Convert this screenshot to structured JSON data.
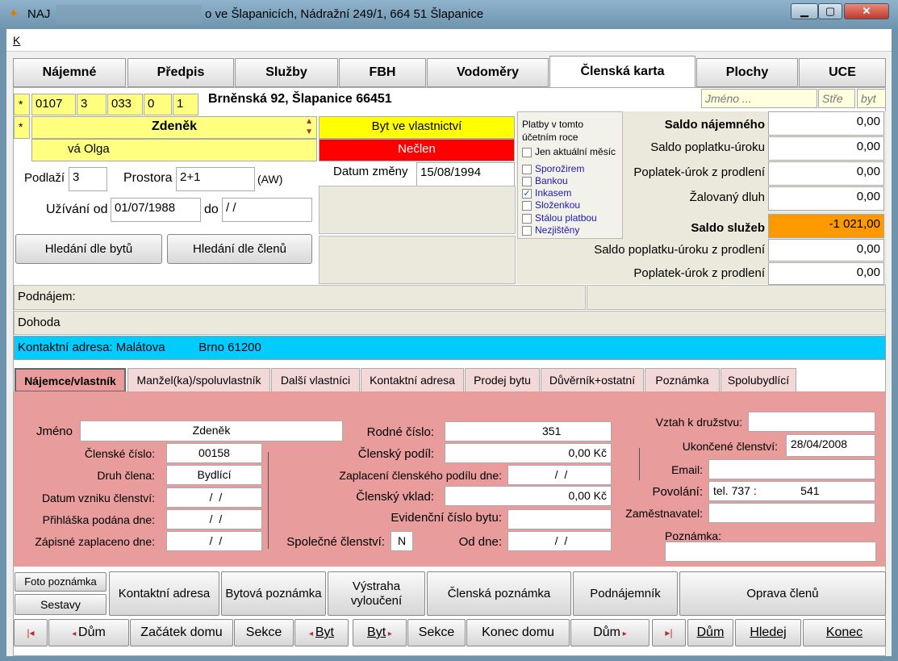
{
  "window": {
    "app": "NAJ",
    "title": "o ve Šlapanicích, Nádražní 249/1, 664 51  Šlapanice",
    "minimize": "▁",
    "maximize": "▢",
    "close": "✕"
  },
  "menu": {
    "item": "K"
  },
  "tabs": [
    "Nájemné",
    "Předpis",
    "Služby",
    "FBH",
    "Vodoměry",
    "Členská karta",
    "Plochy",
    "UCE"
  ],
  "active_tab": "Členská karta",
  "search": {
    "name_placeholder": "Jméno ...",
    "stre": "Stře",
    "byt": "byt"
  },
  "unit": {
    "marker": "*",
    "codes": [
      "0107",
      "3",
      "033",
      "0",
      "1"
    ],
    "address": "Brněnská 92, Šlapanice  66451"
  },
  "persons": {
    "marker": "*",
    "primary": "Zdeněk",
    "secondary": "vá Olga"
  },
  "status": {
    "ownership": "Byt ve vlastnictví",
    "membership": "Nečlen"
  },
  "details": {
    "floor_label": "Podlaží",
    "floor": "3",
    "rooms_label": "Prostora",
    "rooms": "2+1",
    "rooms_note": "(AW)",
    "change_label": "Datum změny",
    "change_date": "15/08/1994",
    "use_from_label": "Užívání od",
    "use_from": "01/07/1988",
    "use_to_label": "do",
    "use_to": " /  /"
  },
  "buttons_search": {
    "by_unit": "Hledání dle bytů",
    "by_member": "Hledání dle členů"
  },
  "platby": {
    "title1": "Platby v tomto",
    "title2": "účetním roce",
    "only_current": "Jen aktuální měsíc",
    "options": [
      {
        "label": "Sporožirem",
        "checked": false
      },
      {
        "label": "Bankou",
        "checked": false
      },
      {
        "label": "Inkasem",
        "checked": true
      },
      {
        "label": "Složenkou",
        "checked": false
      },
      {
        "label": "Stálou platbou",
        "checked": false
      },
      {
        "label": "Nezjištěny",
        "checked": false
      }
    ]
  },
  "saldo": {
    "rent_label": "Saldo nájemného",
    "rent": "0,00",
    "fee_label": "Saldo poplatku-úroku",
    "fee": "0,00",
    "late_label": "Poplatek-úrok z prodlení",
    "late": "0,00",
    "sued_label": "Žalovaný dluh",
    "sued": "0,00",
    "services_label": "Saldo služeb",
    "services": "-1 021,00",
    "svc_fee_label": "Saldo poplatku-úroku z prodlení",
    "svc_fee": "0,00",
    "svc_late_label": "Poplatek-úrok z prodlení",
    "svc_late": "0,00",
    "services_color": "#ff9900"
  },
  "info": {
    "sublet": "Podnájem:",
    "agreement": "Dohoda",
    "contact": "Kontaktní adresa: Malátova          Brno 61200",
    "contact_color": "#00ccff"
  },
  "subtabs": [
    "Nájemce/vlastník",
    "Manžel(ka)/spoluvlastník",
    "Další vlastníci",
    "Kontaktní adresa",
    "Prodej bytu",
    "Důvěrník+ostatní",
    "Poznámka",
    "Spolubydlící"
  ],
  "member": {
    "name_label": "Jméno",
    "name": "Zdeněk",
    "number_label": "Členské číslo:",
    "number": "00158",
    "type_label": "Druh člena:",
    "type": "Bydlící",
    "since_label": "Datum vzniku členství:",
    "since": " /  /",
    "applied_label": "Přihláška podána dne:",
    "applied": " /  /",
    "fee_paid_label": "Zápisné zaplaceno dne:",
    "fee_paid": " /  /",
    "birth_label": "Rodné číslo:",
    "birth": "351",
    "share_label": "Členský podíl:",
    "share": "0,00 Kč",
    "share_paid_label": "Zaplacení členského podílu dne:",
    "share_paid": " /  /",
    "deposit_label": "Členský vklad:",
    "deposit": "0,00 Kč",
    "unit_no_label": "Evidenční číslo bytu:",
    "unit_no": "",
    "joint_label": "Společné členství:",
    "joint": "N",
    "from_label": "Od dne:",
    "from": " /  /",
    "relation_label": "Vztah k družstvu:",
    "relation": "",
    "ended_label": "Ukončené členství:",
    "ended": "28/04/2008",
    "email_label": "Email:",
    "email": "",
    "job_label": "Povolání:",
    "job": "tel. 737 :              541",
    "employer_label": "Zaměstnavatel:",
    "employer": "",
    "note_label": "Poznámka:",
    "note": ""
  },
  "bottom": {
    "photo_note": "Foto poznámka",
    "reports": "Sestavy",
    "contact": "Kontaktní adresa",
    "unit_note": "Bytová poznámka",
    "warning1": "Výstraha",
    "warning2": "vyloučení",
    "member_note": "Členská poznámka",
    "subtenant": "Podnájemník",
    "fix": "Oprava členů"
  },
  "nav": {
    "first": "◂",
    "house_prev": "Dům",
    "house_start": "Začátek domu",
    "section1": "Sekce",
    "unit_prev": "Byt",
    "unit_next": "Byt",
    "section2": "Sekce",
    "house_end": "Konec domu",
    "house_next": "Dům",
    "last": "▸",
    "house": "Dům",
    "find": "Hledej",
    "exit": "Konec"
  }
}
